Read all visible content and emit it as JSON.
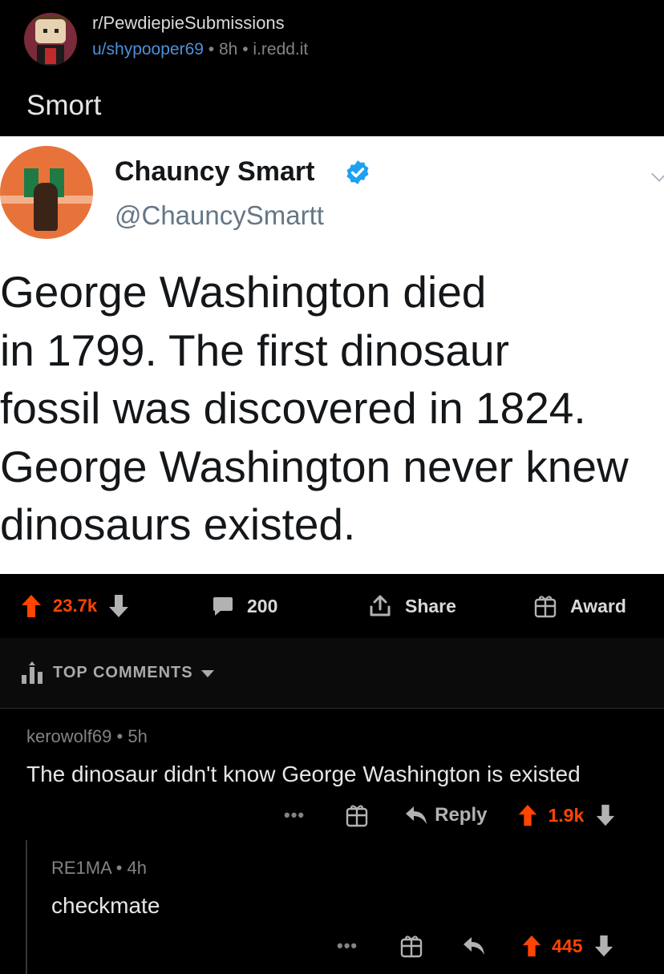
{
  "post": {
    "subreddit": "r/PewdiepieSubmissions",
    "author": "u/shypooper69",
    "sep1": "•",
    "age": "8h",
    "sep2": "•",
    "domain": "i.redd.it",
    "title": "Smort"
  },
  "tweet": {
    "display_name": "Chauncy Smart",
    "handle": "@ChauncySmartt",
    "verified": true,
    "text": "George Washington  died\nin 1799. The first dinosaur\nfossil was discovered in 1824.\nGeorge Washington never knew\ndinosaurs existed."
  },
  "actions": {
    "score": "23.7k",
    "comments": "200",
    "share_label": "Share",
    "award_label": "Award"
  },
  "sort": {
    "label": "TOP COMMENTS"
  },
  "comments": [
    {
      "author": "kerowolf69",
      "sep": "•",
      "age": "5h",
      "body": "The dinosaur didn't know George Washington is existed",
      "more": "•••",
      "reply_label": "Reply",
      "score": "1.9k"
    },
    {
      "author": "RE1MA",
      "sep": "•",
      "age": "4h",
      "body": "checkmate",
      "more": "•••",
      "score": "445"
    }
  ],
  "colors": {
    "background": "#000000",
    "upvote_active": "#ff4500",
    "username_link": "#4f8fd8",
    "twitter_verified": "#1da1f2"
  },
  "icons": [
    "upvote-icon",
    "downvote-icon",
    "comment-bubble-icon",
    "share-icon",
    "award-gift-icon",
    "sort-bars-icon",
    "reply-arrow-icon",
    "more-dots-icon",
    "verified-badge-icon",
    "chevron-down-icon"
  ]
}
